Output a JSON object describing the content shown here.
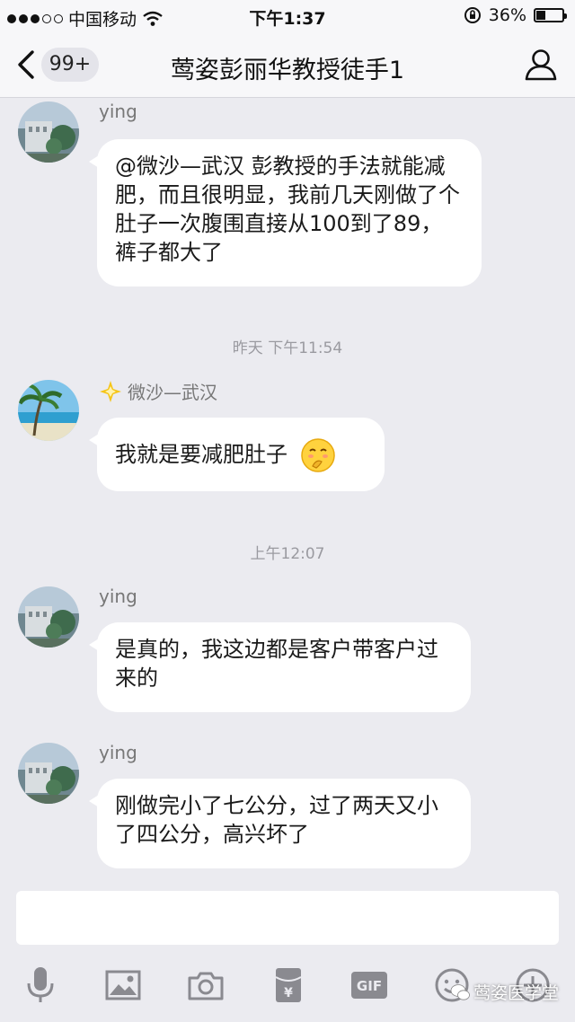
{
  "status_bar": {
    "carrier": "中国移动",
    "time": "下午1:37",
    "battery": "36%",
    "battery_level": 0.36
  },
  "nav": {
    "unread_badge": "99+",
    "title": "莺姿彭丽华教授徒手1"
  },
  "messages": [
    {
      "sender": "ying",
      "text": "@微沙—武汉 彭教授的手法就能减肥，而且很明显，我前几天刚做了个肚子一次腹围直接从100到了89，裤子都大了"
    },
    {
      "timestamp": "昨天  下午11:54"
    },
    {
      "sender": "微沙—武汉",
      "text": "我就是要减肥肚子",
      "emoji": "shy-smile-emoji"
    },
    {
      "timestamp": "上午12:07"
    },
    {
      "sender": "ying",
      "text": "是真的，我这边都是客户带客户过来的"
    },
    {
      "sender": "ying",
      "text": "刚做完小了七公分，过了两天又小了四公分，高兴坏了"
    }
  ],
  "toolbar": {
    "icons": [
      "microphone-icon",
      "image-icon",
      "camera-icon",
      "red-packet-icon",
      "gif-icon",
      "emoji-icon",
      "plus-icon"
    ],
    "gif_label": "GIF",
    "red_packet_label": "¥"
  },
  "watermark": "莺姿医学堂"
}
